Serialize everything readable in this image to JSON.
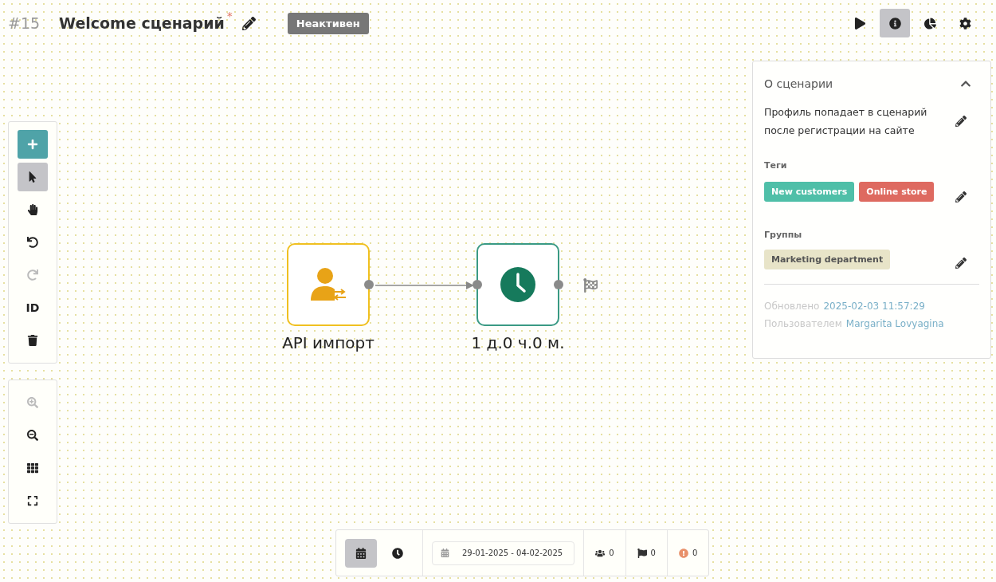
{
  "header": {
    "number": "#15",
    "title": "Welcome сценарий",
    "modified_mark": "*",
    "status": "Неактивен"
  },
  "top_actions": [
    {
      "kind": "play",
      "selected": false
    },
    {
      "kind": "info",
      "selected": true
    },
    {
      "kind": "stats",
      "selected": false
    },
    {
      "kind": "settings",
      "selected": false
    }
  ],
  "tools": [
    {
      "kind": "add",
      "selected": false,
      "disabled": false
    },
    {
      "kind": "select",
      "selected": true,
      "disabled": false
    },
    {
      "kind": "hand",
      "selected": false,
      "disabled": false
    },
    {
      "kind": "undo",
      "selected": false,
      "disabled": false
    },
    {
      "kind": "redo",
      "selected": false,
      "disabled": true
    },
    {
      "kind": "id",
      "label": "ID",
      "selected": false,
      "disabled": false
    },
    {
      "kind": "delete",
      "selected": false,
      "disabled": false
    }
  ],
  "zoom_tools": [
    {
      "kind": "zoom-in",
      "disabled": true
    },
    {
      "kind": "zoom-out",
      "disabled": false
    },
    {
      "kind": "grid",
      "disabled": false
    },
    {
      "kind": "fullscreen",
      "disabled": false
    }
  ],
  "nodes": [
    {
      "kind": "import",
      "label": "API импорт"
    },
    {
      "kind": "delay",
      "label": "1 д.0 ч.0 м."
    }
  ],
  "panel": {
    "title": "О сценарии",
    "expanded": true,
    "description": "Профиль попадает в сценарий после регистрации на сайте",
    "tags_label": "Теги",
    "tags": [
      {
        "label": "New customers",
        "color": "#4fbfa8"
      },
      {
        "label": "Online store",
        "color": "#de6a60"
      }
    ],
    "groups_label": "Группы",
    "groups": [
      "Marketing department"
    ],
    "updated_label": "Обновлено",
    "updated_value": "2025-02-03 11:57:29",
    "user_label": "Пользователем",
    "user_value": "Margarita Lovyagina"
  },
  "bottom_bar": {
    "views": [
      {
        "kind": "calendar",
        "selected": true
      },
      {
        "kind": "clock",
        "selected": false
      }
    ],
    "date_range": "29-01-2025 - 04-02-2025",
    "counters": [
      {
        "kind": "users",
        "value": "0"
      },
      {
        "kind": "flag",
        "value": "0"
      },
      {
        "kind": "error",
        "value": "0"
      }
    ]
  }
}
